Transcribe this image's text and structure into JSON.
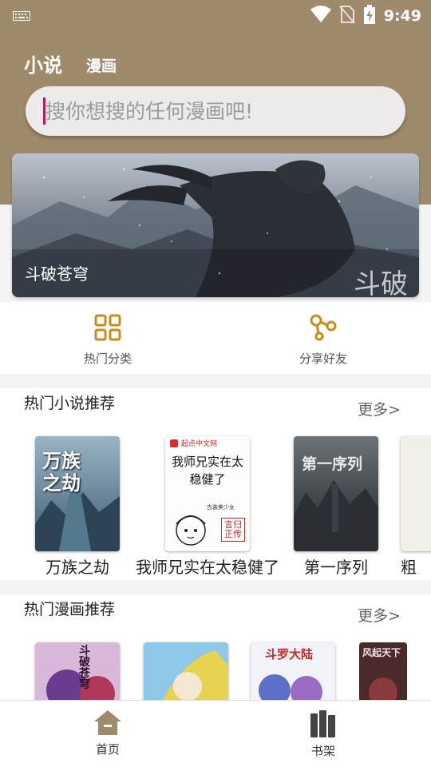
{
  "status_bar": {
    "time": "9:49",
    "icons": [
      "keyboard-icon",
      "wifi-icon",
      "no-sim-icon",
      "battery-charging-icon"
    ]
  },
  "top_tabs": {
    "novel": "小说",
    "comic": "漫画"
  },
  "search": {
    "placeholder": "搜你想搜的任何漫画吧!"
  },
  "banner": {
    "caption": "斗破苍穹",
    "logo_text": "斗破"
  },
  "quick_actions": [
    {
      "label": "热门分类",
      "icon": "grid-category-icon"
    },
    {
      "label": "分享好友",
      "icon": "share-icon"
    }
  ],
  "hot_novels": {
    "title": "热门小说推荐",
    "more": "更多>",
    "books": [
      {
        "title": "万族之劫",
        "cover_text": "万族之劫"
      },
      {
        "title": "我师兄实在太稳健了",
        "cover_text": "我师兄实在太稳健了",
        "cover_brand": "起点中文网",
        "cover_author": "言归正传",
        "cover_sub": "古装美少女"
      },
      {
        "title": "第一序列",
        "cover_text": "第一序列"
      },
      {
        "title": "粗"
      }
    ]
  },
  "hot_comics": {
    "title": "热门漫画推荐",
    "more": "更多>",
    "covers": [
      {
        "cover_text": "斗破苍穹"
      },
      {
        "cover_text": ""
      },
      {
        "cover_text": "斗罗大陆"
      },
      {
        "cover_text": "风起天下"
      }
    ]
  },
  "bottom_nav": [
    {
      "label": "首页",
      "icon": "home-icon"
    },
    {
      "label": "书架",
      "icon": "bookshelf-icon"
    }
  ],
  "colors": {
    "header": "#a08a6c",
    "accent_icon": "#a08a6c",
    "caret": "#c2185b",
    "quick_icon": "#c98b1a"
  }
}
